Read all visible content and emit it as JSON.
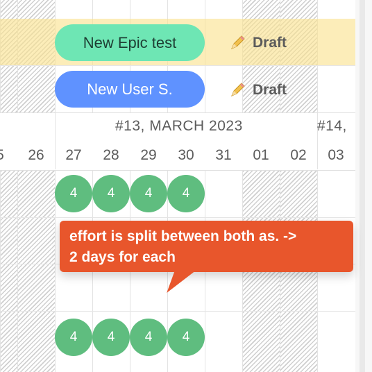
{
  "epics": [
    {
      "name": "New Epic test",
      "status": "Draft"
    },
    {
      "name": "New User S.",
      "status": "Draft"
    }
  ],
  "timeline": {
    "sprints": [
      {
        "label": "#13, MARCH 2023"
      },
      {
        "label": "#14,"
      }
    ],
    "days": [
      "5",
      "26",
      "27",
      "28",
      "29",
      "30",
      "31",
      "01",
      "02",
      "03"
    ]
  },
  "effort_rows": [
    {
      "values": [
        "4",
        "4",
        "4",
        "4"
      ]
    },
    {
      "values": [
        "4",
        "4",
        "4",
        "4"
      ]
    }
  ],
  "callout": {
    "line1": "effort is split between both as. ->",
    "line2": "2 days for each"
  },
  "colors": {
    "epic_green": "#6ee6b4",
    "epic_blue": "#5f92ff",
    "effort_chip": "#5fbd7f",
    "callout_bg": "#e8562c",
    "epic_band": "#fae28e"
  },
  "icons": [
    "pencil-icon"
  ]
}
